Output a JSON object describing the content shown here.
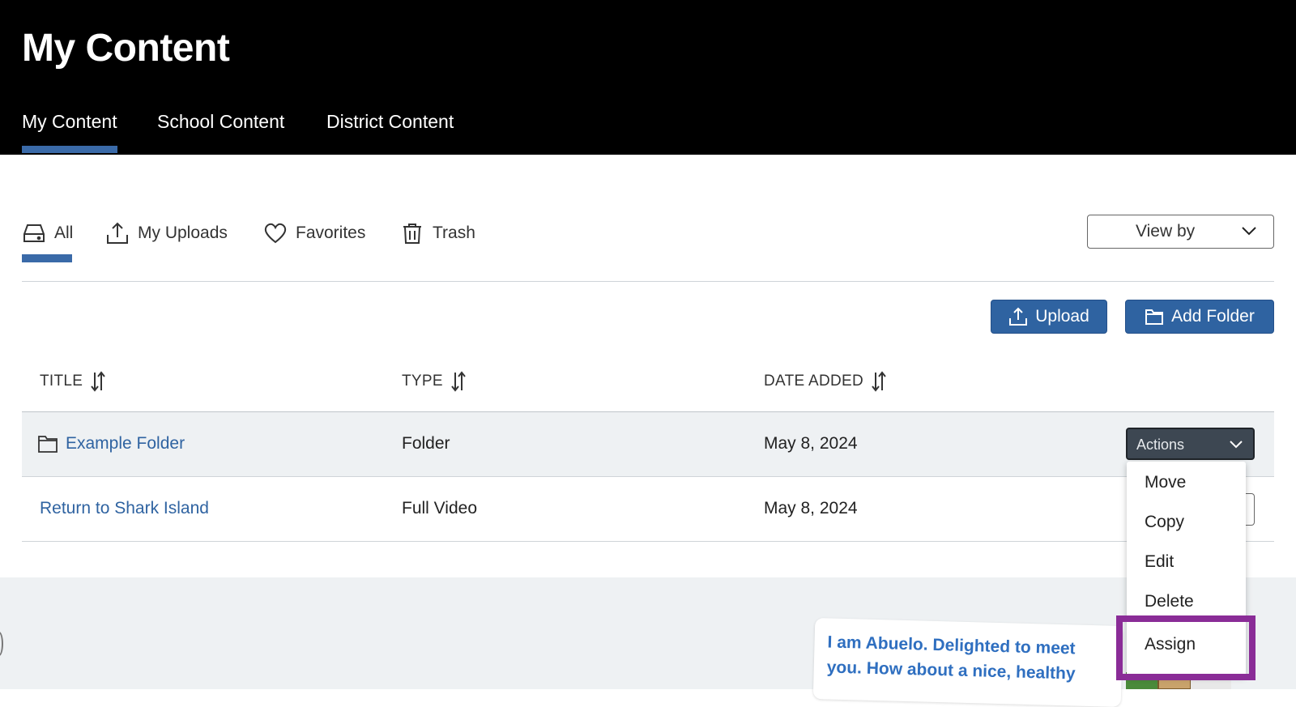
{
  "header": {
    "title": "My Content",
    "tabs": [
      {
        "label": "My Content",
        "active": true
      },
      {
        "label": "School Content",
        "active": false
      },
      {
        "label": "District Content",
        "active": false
      }
    ]
  },
  "subtabs": [
    {
      "label": "All",
      "icon": "inbox-icon",
      "active": true
    },
    {
      "label": "My Uploads",
      "icon": "upload-icon"
    },
    {
      "label": "Favorites",
      "icon": "heart-icon"
    },
    {
      "label": "Trash",
      "icon": "trash-icon"
    }
  ],
  "view_by": {
    "label": "View by"
  },
  "toolbar": {
    "upload_label": "Upload",
    "add_folder_label": "Add Folder"
  },
  "table": {
    "columns": [
      "TITLE",
      "TYPE",
      "DATE ADDED"
    ],
    "rows": [
      {
        "title": "Example Folder",
        "type": "Folder",
        "date": "May 8, 2024",
        "icon": "folder-icon"
      },
      {
        "title": "Return to Shark Island",
        "type": "Full Video",
        "date": "May 8, 2024"
      }
    ]
  },
  "actions": {
    "label": "Actions",
    "menu": [
      "Move",
      "Copy",
      "Edit",
      "Delete",
      "Assign"
    ],
    "highlighted": "Assign"
  },
  "character": {
    "speech": "I am Abuelo. Delighted to meet you. How about a nice, healthy"
  },
  "colors": {
    "accent": "#2f63a1",
    "header_bg": "#000000",
    "highlight": "#8a2c97",
    "speech_text": "#2f6fc0"
  }
}
